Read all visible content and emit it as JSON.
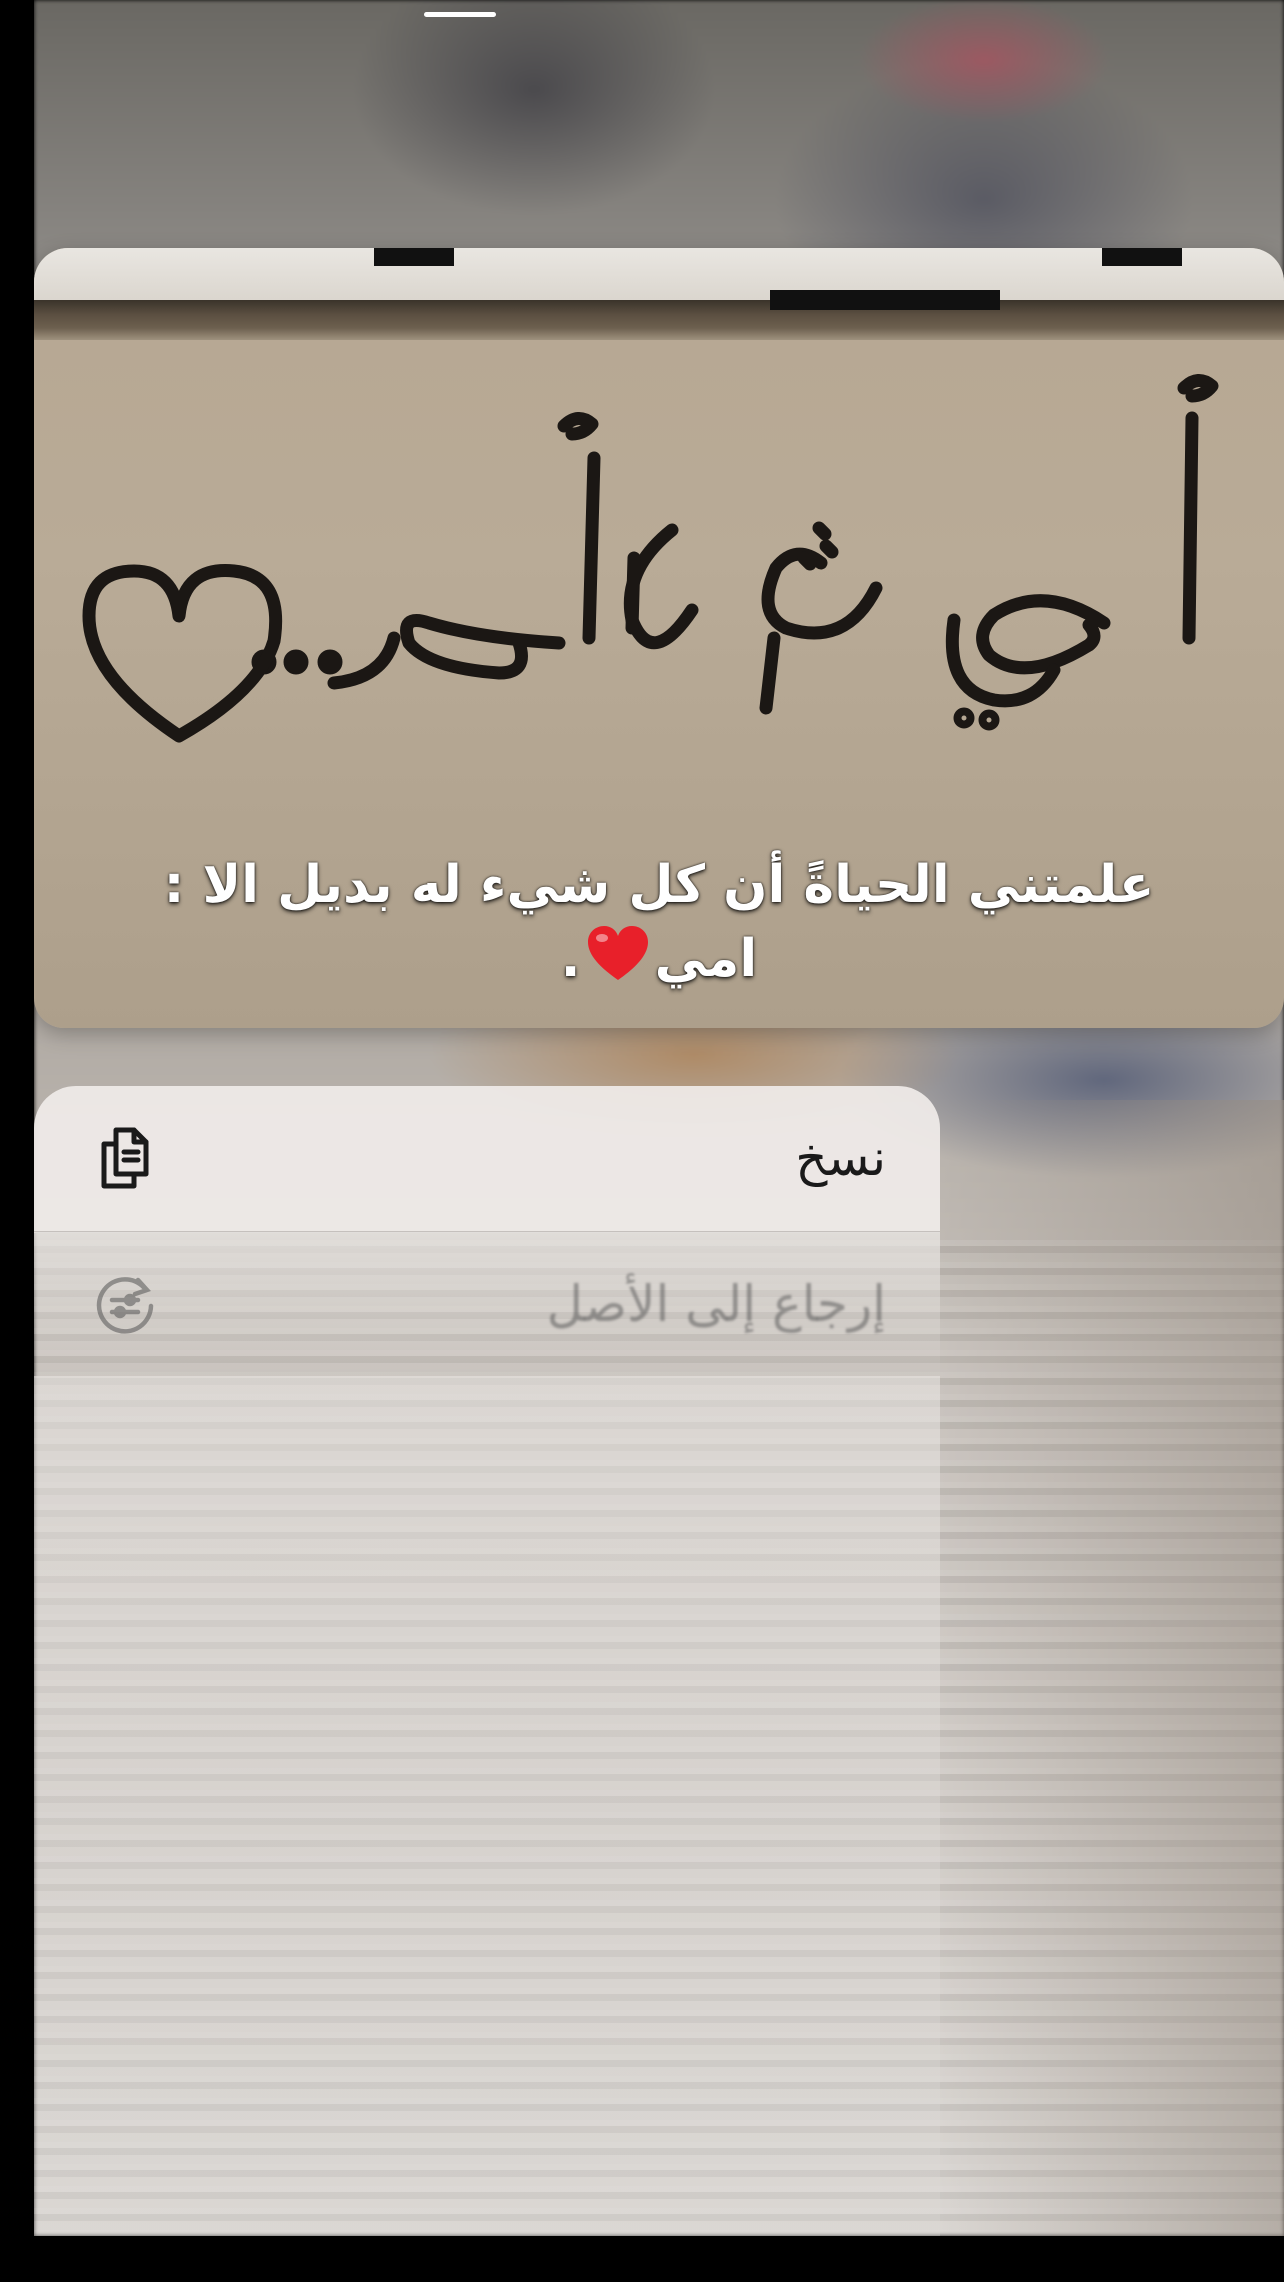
{
  "preview": {
    "graffiti_text": "أمي ثم لا أحد...",
    "caption_line1": "علمتني الحياةً أن كل شيء له بديل الا :",
    "caption_line2_word": "امي",
    "caption_line2_end": "."
  },
  "menu": {
    "items": [
      {
        "label": "نسخ",
        "icon": "copy-icon"
      },
      {
        "label": "إرجاع إلى الأصل",
        "icon": "revert-adjust-icon"
      }
    ]
  },
  "colors": {
    "caption_text": "#ffffff",
    "heart": "#e8202a",
    "menu_text": "#1a1a1a"
  }
}
